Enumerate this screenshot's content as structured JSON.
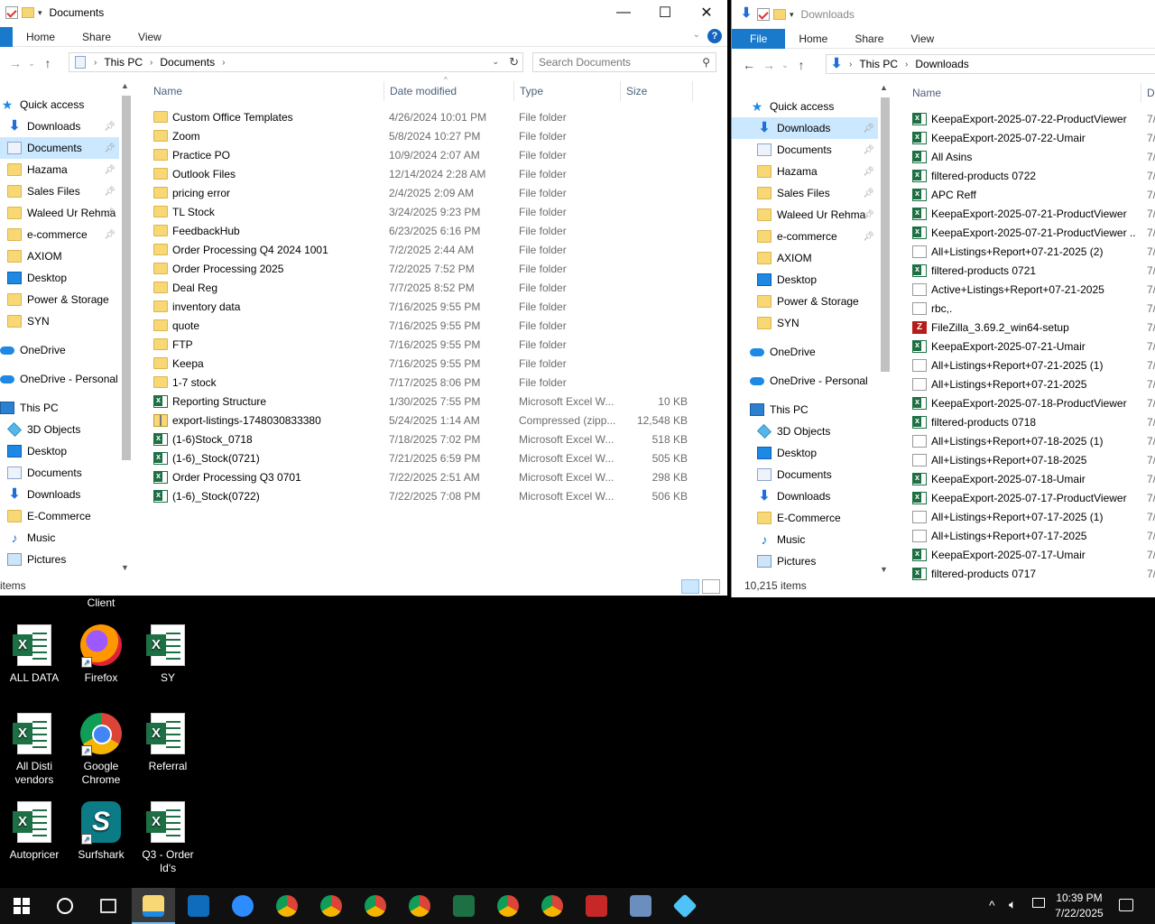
{
  "docs_window": {
    "title": "Documents",
    "ribbon_tabs": [
      "Home",
      "Share",
      "View"
    ],
    "address": [
      "This PC",
      "Documents"
    ],
    "search_placeholder": "Search Documents",
    "columns": [
      "Name",
      "Date modified",
      "Type",
      "Size"
    ],
    "nav": [
      {
        "label": "Quick access",
        "icon": "star-icon"
      },
      {
        "label": "Downloads",
        "icon": "download-icon",
        "pin": true
      },
      {
        "label": "Documents",
        "icon": "documents-icon",
        "pin": true,
        "selected": true
      },
      {
        "label": "Hazama",
        "icon": "folder-icon",
        "pin": true
      },
      {
        "label": "Sales Files",
        "icon": "folder-icon",
        "pin": true
      },
      {
        "label": "Waleed Ur Rehma",
        "icon": "folder-icon",
        "pin": true
      },
      {
        "label": "e-commerce",
        "icon": "folder-icon",
        "pin": true
      },
      {
        "label": "AXIOM",
        "icon": "folder-icon"
      },
      {
        "label": "Desktop",
        "icon": "desktop-icon"
      },
      {
        "label": "Power & Storage",
        "icon": "folder-icon"
      },
      {
        "label": "SYN",
        "icon": "folder-icon"
      },
      {
        "label": "OneDrive",
        "icon": "cloud-icon",
        "gap": true
      },
      {
        "label": "OneDrive - Personal",
        "icon": "cloud-icon",
        "gap": true
      },
      {
        "label": "This PC",
        "icon": "pc-icon",
        "gap": true
      },
      {
        "label": "3D Objects",
        "icon": "3d-objects-icon"
      },
      {
        "label": "Desktop",
        "icon": "desktop-icon"
      },
      {
        "label": "Documents",
        "icon": "documents-icon"
      },
      {
        "label": "Downloads",
        "icon": "download-icon"
      },
      {
        "label": "E-Commerce",
        "icon": "folder-icon"
      },
      {
        "label": "Music",
        "icon": "music-icon"
      },
      {
        "label": "Pictures",
        "icon": "pictures-icon"
      }
    ],
    "files": [
      {
        "name": "Custom Office Templates",
        "date": "4/26/2024 10:01 PM",
        "type": "File folder",
        "size": "",
        "icon": "folder"
      },
      {
        "name": "Zoom",
        "date": "5/8/2024 10:27 PM",
        "type": "File folder",
        "size": "",
        "icon": "folder"
      },
      {
        "name": "Practice PO",
        "date": "10/9/2024 2:07 AM",
        "type": "File folder",
        "size": "",
        "icon": "folder"
      },
      {
        "name": "Outlook Files",
        "date": "12/14/2024 2:28 AM",
        "type": "File folder",
        "size": "",
        "icon": "folder"
      },
      {
        "name": "pricing error",
        "date": "2/4/2025 2:09 AM",
        "type": "File folder",
        "size": "",
        "icon": "folder"
      },
      {
        "name": "TL Stock",
        "date": "3/24/2025 9:23 PM",
        "type": "File folder",
        "size": "",
        "icon": "folder"
      },
      {
        "name": "FeedbackHub",
        "date": "6/23/2025 6:16 PM",
        "type": "File folder",
        "size": "",
        "icon": "folder"
      },
      {
        "name": "Order Processing Q4 2024 1001",
        "date": "7/2/2025 2:44 AM",
        "type": "File folder",
        "size": "",
        "icon": "folder"
      },
      {
        "name": "Order Processing 2025",
        "date": "7/2/2025 7:52 PM",
        "type": "File folder",
        "size": "",
        "icon": "folder"
      },
      {
        "name": "Deal Reg",
        "date": "7/7/2025 8:52 PM",
        "type": "File folder",
        "size": "",
        "icon": "folder"
      },
      {
        "name": "inventory data",
        "date": "7/16/2025 9:55 PM",
        "type": "File folder",
        "size": "",
        "icon": "folder"
      },
      {
        "name": "quote",
        "date": "7/16/2025 9:55 PM",
        "type": "File folder",
        "size": "",
        "icon": "folder"
      },
      {
        "name": "FTP",
        "date": "7/16/2025 9:55 PM",
        "type": "File folder",
        "size": "",
        "icon": "folder"
      },
      {
        "name": "Keepa",
        "date": "7/16/2025 9:55 PM",
        "type": "File folder",
        "size": "",
        "icon": "folder"
      },
      {
        "name": "1-7 stock",
        "date": "7/17/2025 8:06 PM",
        "type": "File folder",
        "size": "",
        "icon": "folder"
      },
      {
        "name": "Reporting Structure",
        "date": "1/30/2025 7:55 PM",
        "type": "Microsoft Excel W...",
        "size": "10 KB",
        "icon": "xls"
      },
      {
        "name": "export-listings-1748030833380",
        "date": "5/24/2025 1:14 AM",
        "type": "Compressed (zipp...",
        "size": "12,548 KB",
        "icon": "zip"
      },
      {
        "name": "(1-6)Stock_0718",
        "date": "7/18/2025 7:02 PM",
        "type": "Microsoft Excel W...",
        "size": "518 KB",
        "icon": "xls"
      },
      {
        "name": "(1-6)_Stock(0721)",
        "date": "7/21/2025 6:59 PM",
        "type": "Microsoft Excel W...",
        "size": "505 KB",
        "icon": "xls"
      },
      {
        "name": "Order Processing Q3 0701",
        "date": "7/22/2025 2:51 AM",
        "type": "Microsoft Excel W...",
        "size": "298 KB",
        "icon": "xls"
      },
      {
        "name": "(1-6)_Stock(0722)",
        "date": "7/22/2025 7:08 PM",
        "type": "Microsoft Excel W...",
        "size": "506 KB",
        "icon": "xls"
      }
    ],
    "status": "items"
  },
  "dl_window": {
    "title": "Downloads",
    "ribbon_tabs": [
      "File",
      "Home",
      "Share",
      "View"
    ],
    "address": [
      "This PC",
      "Downloads"
    ],
    "columns": [
      "Name",
      "D"
    ],
    "nav": [
      {
        "label": "Quick access",
        "icon": "star-icon"
      },
      {
        "label": "Downloads",
        "icon": "download-icon",
        "pin": true,
        "selected": true
      },
      {
        "label": "Documents",
        "icon": "documents-icon",
        "pin": true
      },
      {
        "label": "Hazama",
        "icon": "folder-icon",
        "pin": true
      },
      {
        "label": "Sales Files",
        "icon": "folder-icon",
        "pin": true
      },
      {
        "label": "Waleed Ur Rehma",
        "icon": "folder-icon",
        "pin": true
      },
      {
        "label": "e-commerce",
        "icon": "folder-icon",
        "pin": true
      },
      {
        "label": "AXIOM",
        "icon": "folder-icon"
      },
      {
        "label": "Desktop",
        "icon": "desktop-icon"
      },
      {
        "label": "Power & Storage",
        "icon": "folder-icon"
      },
      {
        "label": "SYN",
        "icon": "folder-icon"
      },
      {
        "label": "OneDrive",
        "icon": "cloud-icon",
        "gap": true
      },
      {
        "label": "OneDrive - Personal",
        "icon": "cloud-icon",
        "gap": true
      },
      {
        "label": "This PC",
        "icon": "pc-icon",
        "gap": true
      },
      {
        "label": "3D Objects",
        "icon": "3d-objects-icon"
      },
      {
        "label": "Desktop",
        "icon": "desktop-icon"
      },
      {
        "label": "Documents",
        "icon": "documents-icon"
      },
      {
        "label": "Downloads",
        "icon": "download-icon"
      },
      {
        "label": "E-Commerce",
        "icon": "folder-icon"
      },
      {
        "label": "Music",
        "icon": "music-icon"
      },
      {
        "label": "Pictures",
        "icon": "pictures-icon"
      }
    ],
    "files": [
      {
        "name": "KeepaExport-2025-07-22-ProductViewer",
        "date": "7/",
        "icon": "xls"
      },
      {
        "name": "KeepaExport-2025-07-22-Umair",
        "date": "7/",
        "icon": "xls"
      },
      {
        "name": "All Asins",
        "date": "7/",
        "icon": "xls"
      },
      {
        "name": "filtered-products 0722",
        "date": "7/",
        "icon": "xls"
      },
      {
        "name": "APC Reff",
        "date": "7/",
        "icon": "xls"
      },
      {
        "name": "KeepaExport-2025-07-21-ProductViewer",
        "date": "7/",
        "icon": "xls"
      },
      {
        "name": "KeepaExport-2025-07-21-ProductViewer ...",
        "date": "7/",
        "icon": "xls"
      },
      {
        "name": "All+Listings+Report+07-21-2025 (2)",
        "date": "7/",
        "icon": "txt"
      },
      {
        "name": "filtered-products 0721",
        "date": "7/",
        "icon": "xls"
      },
      {
        "name": "Active+Listings+Report+07-21-2025",
        "date": "7/",
        "icon": "txt"
      },
      {
        "name": "rbc,.",
        "date": "7/",
        "icon": "txt"
      },
      {
        "name": "FileZilla_3.69.2_win64-setup",
        "date": "7/",
        "icon": "fz"
      },
      {
        "name": "KeepaExport-2025-07-21-Umair",
        "date": "7/",
        "icon": "xls"
      },
      {
        "name": "All+Listings+Report+07-21-2025 (1)",
        "date": "7/",
        "icon": "txt"
      },
      {
        "name": "All+Listings+Report+07-21-2025",
        "date": "7/",
        "icon": "txt"
      },
      {
        "name": "KeepaExport-2025-07-18-ProductViewer",
        "date": "7/",
        "icon": "xls"
      },
      {
        "name": "filtered-products 0718",
        "date": "7/",
        "icon": "xls"
      },
      {
        "name": "All+Listings+Report+07-18-2025 (1)",
        "date": "7/",
        "icon": "txt"
      },
      {
        "name": "All+Listings+Report+07-18-2025",
        "date": "7/",
        "icon": "txt"
      },
      {
        "name": "KeepaExport-2025-07-18-Umair",
        "date": "7/",
        "icon": "xls"
      },
      {
        "name": "KeepaExport-2025-07-17-ProductViewer",
        "date": "7/",
        "icon": "xls"
      },
      {
        "name": "All+Listings+Report+07-17-2025 (1)",
        "date": "7/",
        "icon": "txt"
      },
      {
        "name": "All+Listings+Report+07-17-2025",
        "date": "7/",
        "icon": "txt"
      },
      {
        "name": "KeepaExport-2025-07-17-Umair",
        "date": "7/",
        "icon": "xls"
      },
      {
        "name": "filtered-products 0717",
        "date": "7/",
        "icon": "xls"
      }
    ],
    "status": "10,215 items"
  },
  "desktop": {
    "cut_label": "Client",
    "icons": [
      {
        "label": "ALL DATA",
        "kind": "excel"
      },
      {
        "label": "Firefox",
        "kind": "firefox"
      },
      {
        "label": "SY",
        "kind": "excel"
      },
      {
        "label": "All Disti vendors",
        "kind": "excel"
      },
      {
        "label": "Google Chrome",
        "kind": "chrome"
      },
      {
        "label": "Referral",
        "kind": "excel"
      },
      {
        "label": "Autopricer",
        "kind": "excel"
      },
      {
        "label": "Surfshark",
        "kind": "surfshark"
      },
      {
        "label": "Q3 - Order Id's",
        "kind": "excel"
      }
    ]
  },
  "taskbar": {
    "apps": [
      "start-icon",
      "search-icon",
      "task-view-icon",
      "file-explorer-icon",
      "outlook-icon",
      "zoom-icon",
      "chrome-profile-w-icon",
      "chrome-profile-2-icon",
      "chrome-profile-3-icon",
      "chrome-profile-4-icon",
      "excel-icon",
      "chrome-profile-5-icon",
      "chrome-profile-6-icon",
      "filezilla-icon",
      "calculator-icon",
      "app-diamond-icon"
    ],
    "time": "10:39 PM",
    "date": "7/22/2025"
  }
}
